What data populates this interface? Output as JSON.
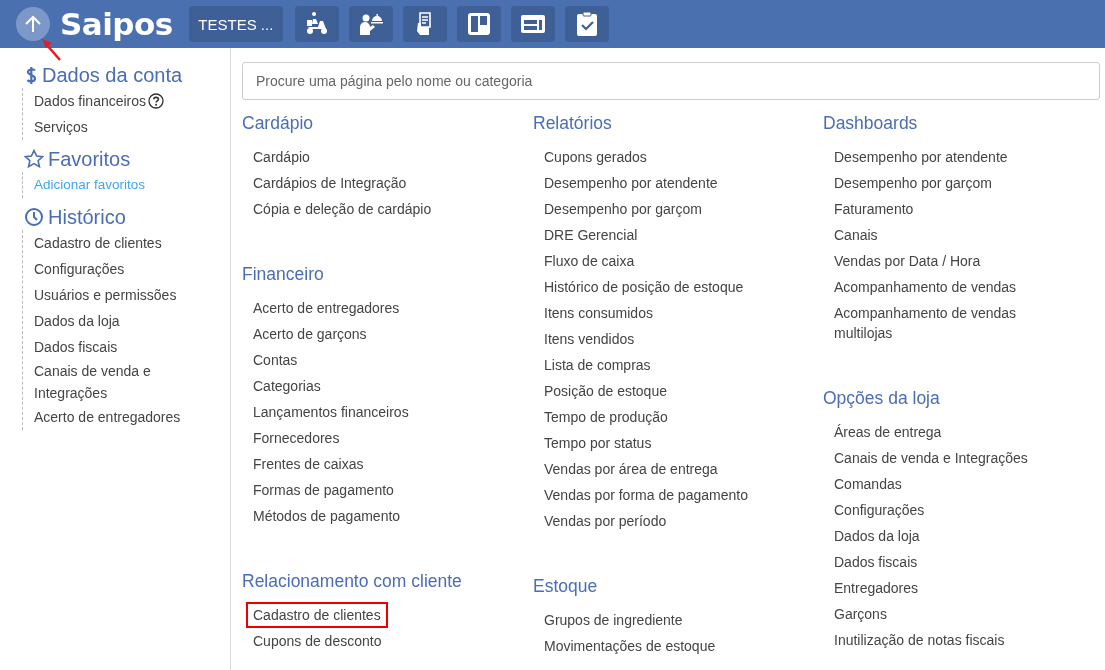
{
  "header": {
    "logo": "Saipos",
    "store_button": "TESTES ...",
    "toolbar": [
      {
        "kind": "delivery"
      },
      {
        "kind": "waiter"
      },
      {
        "kind": "order-ticket"
      },
      {
        "kind": "board"
      },
      {
        "kind": "panel"
      },
      {
        "kind": "checklist"
      }
    ]
  },
  "sidebar": {
    "sections": [
      {
        "kind": "account",
        "title": "Dados da conta",
        "items": [
          {
            "label": "Dados financeiros",
            "help": true
          },
          {
            "label": "Serviços",
            "help": false
          }
        ]
      },
      {
        "kind": "favorites",
        "title": "Favoritos",
        "items": [
          {
            "label": "Adicionar favoritos",
            "link": true
          }
        ]
      },
      {
        "kind": "history",
        "title": "Histórico",
        "items": [
          {
            "label": "Cadastro de clientes"
          },
          {
            "label": "Configurações"
          },
          {
            "label": "Usuários e permissões"
          },
          {
            "label": "Dados da loja"
          },
          {
            "label": "Dados fiscais"
          },
          {
            "label": "Canais de venda e Integrações"
          },
          {
            "label": "Acerto de entregadores"
          }
        ]
      }
    ]
  },
  "search": {
    "placeholder": "Procure uma página pelo nome ou categoria"
  },
  "columns": [
    [
      {
        "title": "Cardápio",
        "items": [
          {
            "label": "Cardápio"
          },
          {
            "label": "Cardápios de Integração"
          },
          {
            "label": "Cópia e deleção de cardápio"
          }
        ]
      },
      {
        "title": "Financeiro",
        "items": [
          {
            "label": "Acerto de entregadores"
          },
          {
            "label": "Acerto de garçons"
          },
          {
            "label": "Contas"
          },
          {
            "label": "Categorias"
          },
          {
            "label": "Lançamentos financeiros"
          },
          {
            "label": "Fornecedores"
          },
          {
            "label": "Frentes de caixas"
          },
          {
            "label": "Formas de pagamento"
          },
          {
            "label": "Métodos de pagamento"
          }
        ]
      },
      {
        "title": "Relacionamento com cliente",
        "items": [
          {
            "label": "Cadastro de clientes",
            "highlighted": true
          },
          {
            "label": "Cupons de desconto"
          }
        ]
      }
    ],
    [
      {
        "title": "Relatórios",
        "items": [
          {
            "label": "Cupons gerados"
          },
          {
            "label": "Desempenho por atendente"
          },
          {
            "label": "Desempenho por garçom"
          },
          {
            "label": "DRE Gerencial"
          },
          {
            "label": "Fluxo de caixa"
          },
          {
            "label": "Histórico de posição de estoque"
          },
          {
            "label": "Itens consumidos"
          },
          {
            "label": "Itens vendidos"
          },
          {
            "label": "Lista de compras"
          },
          {
            "label": "Posição de estoque"
          },
          {
            "label": "Tempo de produção"
          },
          {
            "label": "Tempo por status"
          },
          {
            "label": "Vendas por área de entrega"
          },
          {
            "label": "Vendas por forma de pagamento"
          },
          {
            "label": "Vendas por período"
          }
        ]
      },
      {
        "title": "Estoque",
        "items": [
          {
            "label": "Grupos de ingrediente"
          },
          {
            "label": "Movimentações de estoque"
          }
        ]
      }
    ],
    [
      {
        "title": "Dashboards",
        "items": [
          {
            "label": "Desempenho por atendente"
          },
          {
            "label": "Desempenho por garçom"
          },
          {
            "label": "Faturamento"
          },
          {
            "label": "Canais"
          },
          {
            "label": "Vendas por Data / Hora"
          },
          {
            "label": "Acompanhamento de vendas"
          },
          {
            "label": "Acompanhamento de vendas multilojas"
          }
        ]
      },
      {
        "title": "Opções da loja",
        "items": [
          {
            "label": "Áreas de entrega"
          },
          {
            "label": "Canais de venda e Integrações"
          },
          {
            "label": "Comandas"
          },
          {
            "label": "Configurações"
          },
          {
            "label": "Dados da loja"
          },
          {
            "label": "Dados fiscais"
          },
          {
            "label": "Entregadores"
          },
          {
            "label": "Garçons"
          },
          {
            "label": "Inutilização de notas fiscais"
          }
        ]
      }
    ]
  ],
  "annotation": {
    "arrow": true
  }
}
